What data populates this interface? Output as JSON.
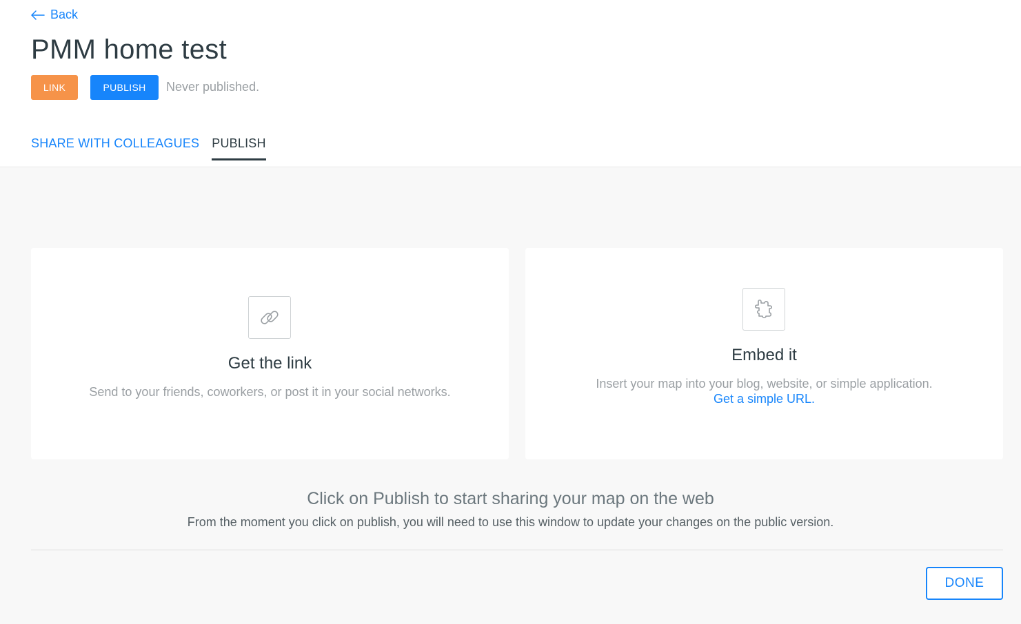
{
  "header": {
    "back_label": "Back",
    "title": "PMM home test",
    "link_button": "LINK",
    "publish_button": "PUBLISH",
    "status": "Never published."
  },
  "tabs": [
    {
      "label": "SHARE WITH COLLEAGUES",
      "active": false
    },
    {
      "label": "PUBLISH",
      "active": true
    }
  ],
  "cards": {
    "link": {
      "icon": "link-icon",
      "title": "Get the link",
      "description": "Send to your friends, coworkers, or post it in your social networks."
    },
    "embed": {
      "icon": "puzzle-icon",
      "title": "Embed it",
      "description": "Insert your map into your blog, website, or simple application.",
      "link": "Get a simple URL."
    }
  },
  "footer": {
    "headline": "Click on Publish to start sharing your map on the web",
    "subline": "From the moment you click on publish, you will need to use this window to update your changes on the public version.",
    "done_button": "DONE"
  },
  "colors": {
    "accent": "#1785fb",
    "link_button": "#f69349",
    "text": "#2e3c43",
    "muted": "#9a9fa3",
    "background": "#f8f8f8"
  }
}
